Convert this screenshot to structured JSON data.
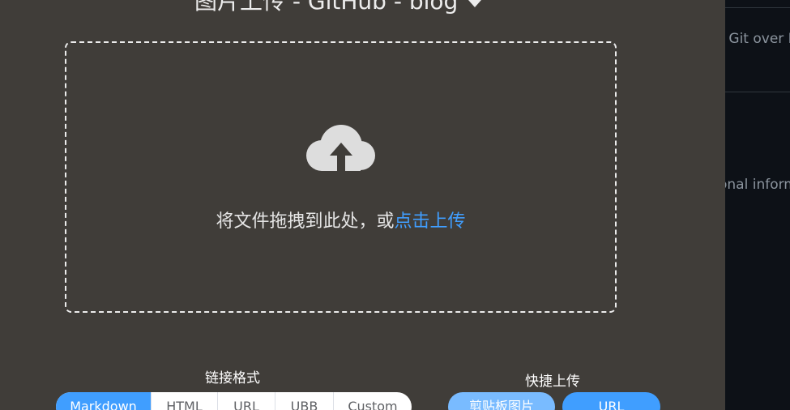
{
  "picbed": {
    "title": "图片上传 - GitHub - blog",
    "dropzone_text": "将文件拖拽到此处，或",
    "dropzone_link": "点击上传",
    "link_format": {
      "label": "链接格式",
      "options": [
        "Markdown",
        "HTML",
        "URL",
        "UBB",
        "Custom"
      ],
      "selected": "Markdown"
    },
    "quick_upload": {
      "label": "快捷上传",
      "clipboard_button": "剪贴板图片",
      "url_button": "URL"
    }
  },
  "background_page": {
    "text_1": "r Git over H",
    "text_2": "onal inform"
  },
  "colors": {
    "panel_bg": "#403d39",
    "accent": "#409eff",
    "accent_light": "#79bbff",
    "background_page": "#0d1117"
  }
}
